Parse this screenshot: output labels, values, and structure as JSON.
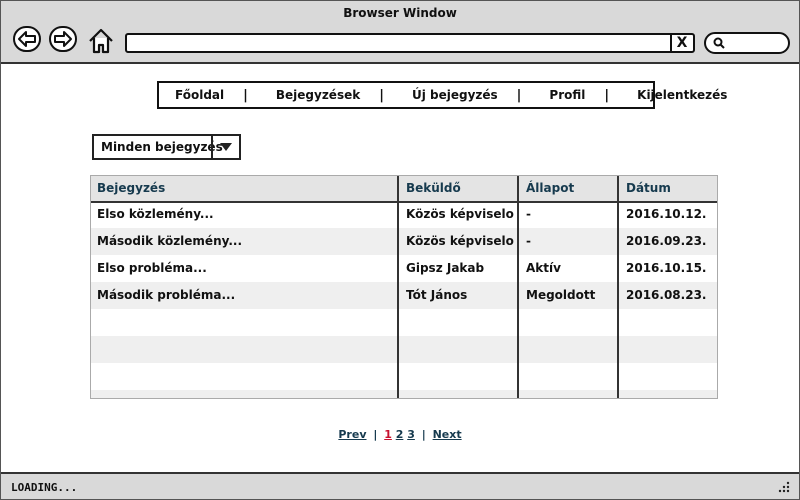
{
  "window": {
    "title": "Browser Window"
  },
  "toolbar": {
    "address_value": "",
    "clear_symbol": "X"
  },
  "menu": {
    "items": [
      "Főoldal",
      "Bejegyzések",
      "Új bejegyzés",
      "Profil",
      "Kijelentkezés"
    ],
    "separator": "|"
  },
  "filter": {
    "selected": "Minden bejegyzés"
  },
  "table": {
    "headers": [
      "Bejegyzés",
      "Beküldő",
      "Állapot",
      "Dátum"
    ],
    "rows": [
      [
        "Elso közlemény...",
        "Közös képviselo",
        "-",
        "2016.10.12."
      ],
      [
        "Második közlemény...",
        "Közös képviselo",
        "-",
        "2016.09.23."
      ],
      [
        "Elso probléma...",
        "Gipsz Jakab",
        "Aktív",
        "2016.10.15."
      ],
      [
        "Második probléma...",
        "Tót János",
        "Megoldott",
        "2016.08.23."
      ]
    ]
  },
  "pagination": {
    "prev": "Prev",
    "pages": [
      "1",
      "2",
      "3"
    ],
    "current": "1",
    "next": "Next",
    "separator": "|"
  },
  "status": {
    "text": "LOADING..."
  },
  "colors": {
    "chrome": "#d9d9d9",
    "header_text": "#163a4e",
    "current_page": "#c8102e"
  },
  "icons": [
    "back-icon",
    "forward-icon",
    "home-icon",
    "search-icon",
    "dropdown-arrow-icon",
    "resize-grip-icon"
  ]
}
